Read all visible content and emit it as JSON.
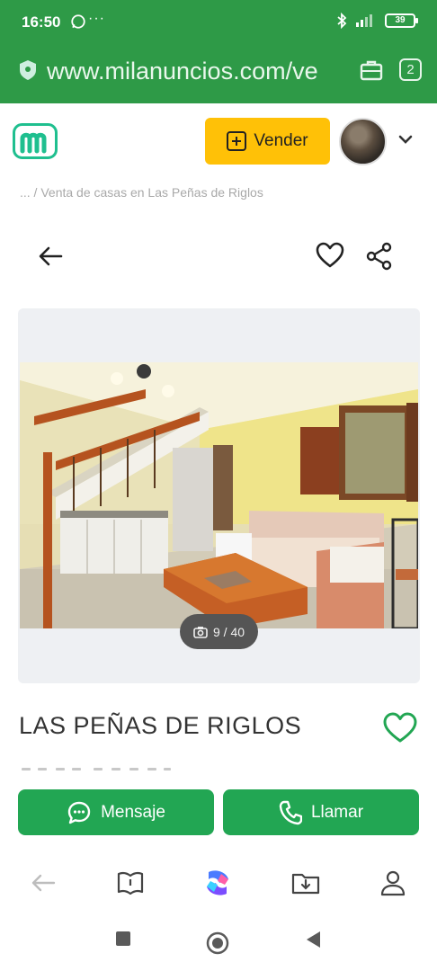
{
  "status_bar": {
    "time": "16:50",
    "dots": "···",
    "battery": "39"
  },
  "browser": {
    "url": "www.milanuncios.com/ve",
    "tab_count": "2"
  },
  "header": {
    "sell_label": "Vender"
  },
  "breadcrumb": "... / Venta de casas en Las Peñas de Riglos",
  "gallery": {
    "counter": "9 / 40"
  },
  "listing": {
    "title": "LAS PEÑAS DE RIGLOS"
  },
  "actions": {
    "message_label": "Mensaje",
    "call_label": "Llamar"
  },
  "colors": {
    "brand_green": "#2e9a47",
    "button_green": "#22a653",
    "sell_yellow": "#ffc107",
    "logo_teal": "#1fbf8f"
  }
}
